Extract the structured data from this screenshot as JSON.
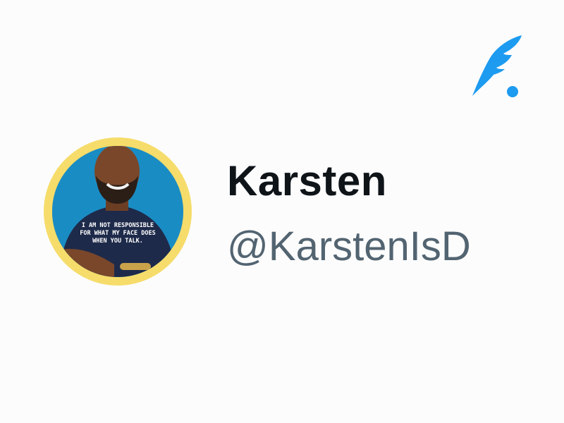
{
  "profile": {
    "display_name": "Karsten",
    "username": "@KarstenIsD",
    "avatar_shirt_text": [
      "I AM NOT RESPONSIBLE",
      "FOR WHAT MY FACE DOES",
      "WHEN YOU TALK."
    ]
  },
  "icons": {
    "brand": "quill-feather-dot-icon"
  },
  "colors": {
    "accent": "#1d9bf0",
    "avatar_ring": "#f6dc6a",
    "avatar_background": "#1a8cc4",
    "name_text": "#0f1419",
    "username_text": "#536471",
    "page_background": "#fcfcfd"
  }
}
